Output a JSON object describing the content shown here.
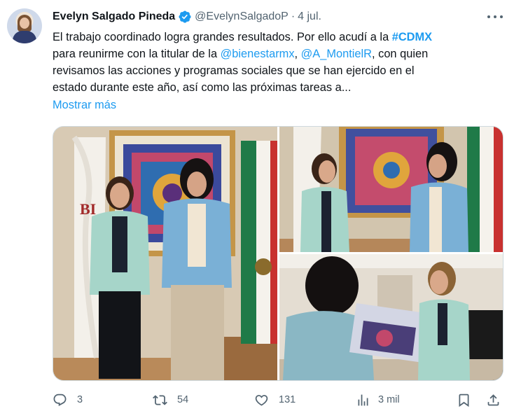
{
  "tweet": {
    "author_name": "Evelyn Salgado Pineda",
    "handle": "@EvelynSalgadoP",
    "separator": "·",
    "date": "4 jul.",
    "text": {
      "l1_a": "El trabajo coordinado logra grandes resultados. Por ello acudí a la ",
      "l1_hashtag": "#CDMX",
      "l2_a": "para reunirme con la titular de la ",
      "l2_mention1": "@bienestarmx",
      "l2_b": ", ",
      "l2_mention2": "@A_MontielR",
      "l2_c": ", con quien",
      "l3": "revisamos las acciones y programas sociales que se han ejercido en el",
      "l4": "estado durante este año, así como las próximas tareas a..."
    },
    "show_more": "Mostrar más"
  },
  "actions": {
    "replies": "3",
    "retweets": "54",
    "likes": "131",
    "views": "3 mil"
  },
  "icons": {
    "verified": "verified-badge-icon",
    "more": "more-options-icon",
    "reply": "reply-icon",
    "retweet": "retweet-icon",
    "like": "heart-icon",
    "views": "views-chart-icon",
    "bookmark": "bookmark-icon",
    "share": "share-icon"
  },
  "colors": {
    "accent": "#1d9bf0",
    "text": "#0f1419",
    "secondary": "#536471",
    "border": "#cfd9de"
  }
}
